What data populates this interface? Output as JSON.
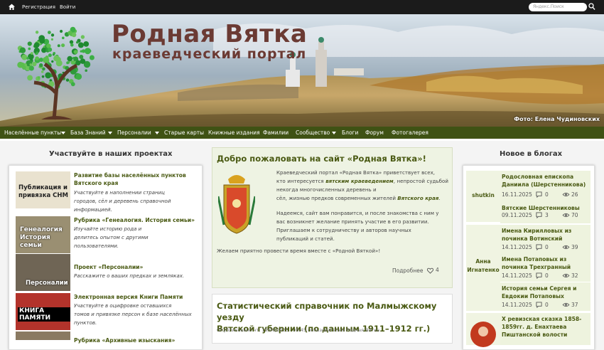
{
  "topbar": {
    "register": "Регистрация",
    "login": "Войти",
    "search_placeholder": "Яндекс.Поиск"
  },
  "banner": {
    "title": "Родная Вятка",
    "subtitle": "краеведческий портал",
    "credit": "Фото: Елена Чудиновских"
  },
  "nav": [
    "Населённые пункты",
    "База Знаний",
    "Персоналии",
    "Старые карты",
    "Книжные издания",
    "Фамилии",
    "Сообщество",
    "Блоги",
    "Форум",
    "Фотогалерея"
  ],
  "left": {
    "heading": "Участвуйте в наших проектах",
    "projects": [
      {
        "title": "Развитие базы населённых пунктов Вятского края",
        "desc": [
          "Участвуйте в наполнении страниц",
          "городов, сёл и деревень справочной",
          "информацией."
        ],
        "thumb": "Публикация и привязка СНМ"
      },
      {
        "title": "Рубрика «Генеалогия. История семьи»",
        "desc": [
          "Изучайте историю рода и",
          "делитесь опытом с другими",
          "пользователями."
        ],
        "thumb": "Генеалогия История семьи"
      },
      {
        "title": "Проект «Персоналии»",
        "desc": [
          "Расскажите о ваших предках и земляках."
        ],
        "thumb": "Персоналии"
      },
      {
        "title": "Электронная версия Книги Памяти",
        "desc": [
          "Участвуйте в оцифровке оставшихся",
          "томов и привязке персон к базе населённых",
          "пунктов."
        ],
        "thumb": "КНИГА ПАМЯТИ"
      },
      {
        "title": "Рубрика «Архивные изыскания»",
        "desc": [],
        "thumb": ""
      }
    ]
  },
  "welcome": {
    "title": "Добро пожаловать на сайт «Родная Вятка»!",
    "p1_a": "Краеведческий портал «Родная Вятка» приветствует всех,",
    "p1_b": "кто интересуется ",
    "p1_b_em": "вятским краеведением",
    "p1_c": ", непростой судьбой некогда многочисленных деревень и",
    "p1_d": "сёл, жизнью предков современных жителей ",
    "p1_d_em": "Вятского края",
    "p2_a": "Надеемся, сайт вам понравится, и после знакомства с ним у",
    "p2_b": "вас возникнет желание принять участие в его развитии.",
    "p2_c": "Приглашаем к сотрудничеству и авторов научных",
    "p2_d": "публикаций и статей.",
    "p3": "Желаем приятно провести время вместе с «Родной Вяткой»!",
    "more": "Подробнее",
    "likes": "4"
  },
  "article": {
    "title_1": "Статистический справочник по Малмыжскому уезду",
    "title_2": "Вятской губернии (по данным 1911–1912 гг.)",
    "meta": "Опубликовано чт, 19/06/2025 - 08:45 пользователем Родная Вятка"
  },
  "right": {
    "heading": "Новое в блогах",
    "authors": [
      "shutkin",
      "Анна Игнатенко"
    ],
    "posts": [
      {
        "title_1": "Родословная епископа",
        "title_2": "Даниила (Шерстенникова)",
        "date": "16.11.2025",
        "comments": "0",
        "views": "26"
      },
      {
        "title_1": "Вятские Шерстенниковы",
        "title_2": "",
        "date": "09.11.2025",
        "comments": "3",
        "views": "70"
      },
      {
        "title_1": "Имена Кирилловых из",
        "title_2": "починка Вотинский",
        "date": "14.11.2025",
        "comments": "0",
        "views": "39"
      },
      {
        "title_1": "Имена Потаповых из",
        "title_2": "починка Трехгранный",
        "date": "14.11.2025",
        "comments": "0",
        "views": "32"
      },
      {
        "title_1": "История семьи Сергея и",
        "title_2": "Евдокии Потаповых",
        "date": "14.11.2025",
        "comments": "0",
        "views": "37"
      },
      {
        "title_1": "Х ревизская сказка 1858-",
        "title_2": "1859гг. д. Енахтаева",
        "title_3": "Пиштанской волости",
        "date": "",
        "comments": "",
        "views": ""
      }
    ]
  },
  "colors": {
    "accent": "#4a5a13",
    "nav": "#3f5214",
    "title": "#6b3a33"
  }
}
